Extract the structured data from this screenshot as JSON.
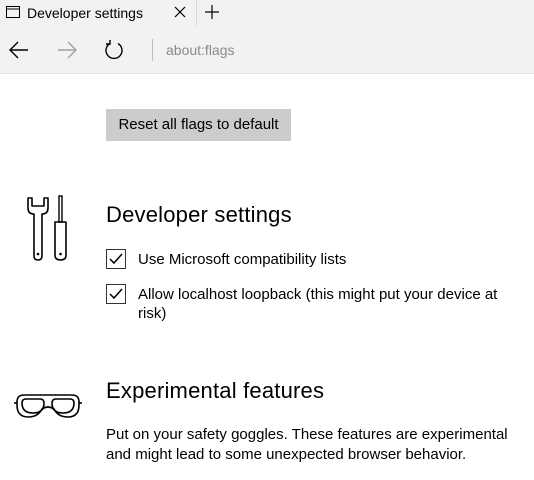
{
  "tab": {
    "title": "Developer settings"
  },
  "address_bar": {
    "value": "about:flags"
  },
  "reset_button_label": "Reset all flags to default",
  "developer_section": {
    "heading": "Developer settings",
    "options": [
      {
        "label": "Use Microsoft compatibility lists",
        "checked": true
      },
      {
        "label": "Allow localhost loopback (this might put your device at risk)",
        "checked": true
      }
    ]
  },
  "experimental_section": {
    "heading": "Experimental features",
    "description": "Put on your safety goggles. These features are experimental and might lead to some unexpected browser behavior."
  },
  "icons": {
    "tab": "page-icon",
    "close": "close-icon",
    "new_tab": "plus-icon",
    "back": "back-arrow-icon",
    "forward": "forward-arrow-icon",
    "refresh": "refresh-icon",
    "developer": "tools-icon",
    "experimental": "goggles-icon"
  },
  "colors": {
    "chrome_background": "#f2f2f2",
    "button_background": "#cccccc",
    "address_text": "#8a8a8a"
  }
}
